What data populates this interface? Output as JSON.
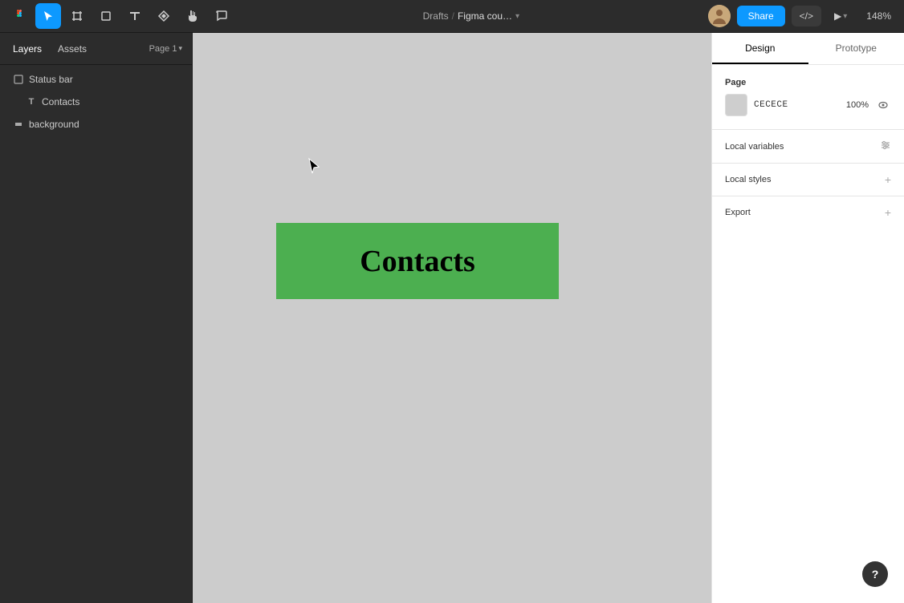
{
  "toolbar": {
    "menu_icon": "≡",
    "tool_select_label": "Select",
    "tool_frame_label": "Frame",
    "tool_shape_label": "Shape",
    "tool_text_label": "Text",
    "tool_components_label": "Components",
    "tool_hand_label": "Hand",
    "tool_comment_label": "Comment",
    "breadcrumb_drafts": "Drafts",
    "breadcrumb_sep": "/",
    "breadcrumb_current": "Figma cou…",
    "share_label": "Share",
    "code_label": "</>",
    "play_label": "▶",
    "zoom_label": "148%"
  },
  "left_panel": {
    "tab_layers": "Layers",
    "tab_assets": "Assets",
    "page_selector": "Page 1",
    "layers": [
      {
        "id": "status-bar",
        "name": "Status bar",
        "icon": "rect",
        "indent": 0
      },
      {
        "id": "contacts-text",
        "name": "Contacts",
        "icon": "T",
        "indent": 1
      },
      {
        "id": "background",
        "name": "background",
        "icon": "rect-small",
        "indent": 0
      }
    ]
  },
  "canvas": {
    "contacts_text": "Contacts",
    "background_color": "#CCCCCC",
    "contacts_bg_color": "#4CAF50"
  },
  "right_panel": {
    "tab_design": "Design",
    "tab_prototype": "Prototype",
    "active_tab": "design",
    "page_section": {
      "label": "Page",
      "color_value": "CECECE",
      "opacity_value": "100%"
    },
    "local_variables": {
      "label": "Local variables",
      "icon": "sliders"
    },
    "local_styles": {
      "label": "Local styles",
      "add_icon": "+"
    },
    "export": {
      "label": "Export",
      "add_icon": "+"
    }
  },
  "help": {
    "label": "?"
  }
}
